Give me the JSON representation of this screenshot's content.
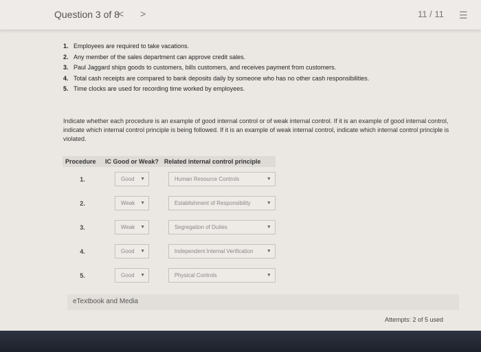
{
  "header": {
    "question_label": "Question 3 of 8",
    "prev": "<",
    "next": ">",
    "page_count": "11 / 11",
    "menu_icon": "list-icon"
  },
  "procedures": [
    {
      "num": "1.",
      "text": "Employees are required to take vacations."
    },
    {
      "num": "2.",
      "text": "Any member of the sales department can approve credit sales."
    },
    {
      "num": "3.",
      "text": "Paul Jaggard ships goods to customers, bills customers, and receives payment from customers."
    },
    {
      "num": "4.",
      "text": "Total cash receipts are compared to bank deposits daily by someone who has no other cash responsibilities."
    },
    {
      "num": "5.",
      "text": "Time clocks are used for recording time worked by employees."
    }
  ],
  "instructions": "Indicate whether each procedure is an example of good internal control or of weak internal control. If it is an example of good internal control, indicate which internal control principle is being followed. If it is an example of weak internal control, indicate which internal control principle is violated.",
  "table": {
    "headers": [
      "Procedure",
      "IC Good or Weak?",
      "Related internal control principle"
    ],
    "rows": [
      {
        "num": "1.",
        "ic": "Good",
        "principle": "Human Resource Controls"
      },
      {
        "num": "2.",
        "ic": "Weak",
        "principle": "Establishment of Responsibility"
      },
      {
        "num": "3.",
        "ic": "Weak",
        "principle": "Segregation of Duties"
      },
      {
        "num": "4.",
        "ic": "Good",
        "principle": "Independent Internal Verification"
      },
      {
        "num": "5.",
        "ic": "Good",
        "principle": "Physical Controls"
      }
    ]
  },
  "etextbook": "eTextbook and Media",
  "attempts": "Attempts: 2 of 5 used"
}
